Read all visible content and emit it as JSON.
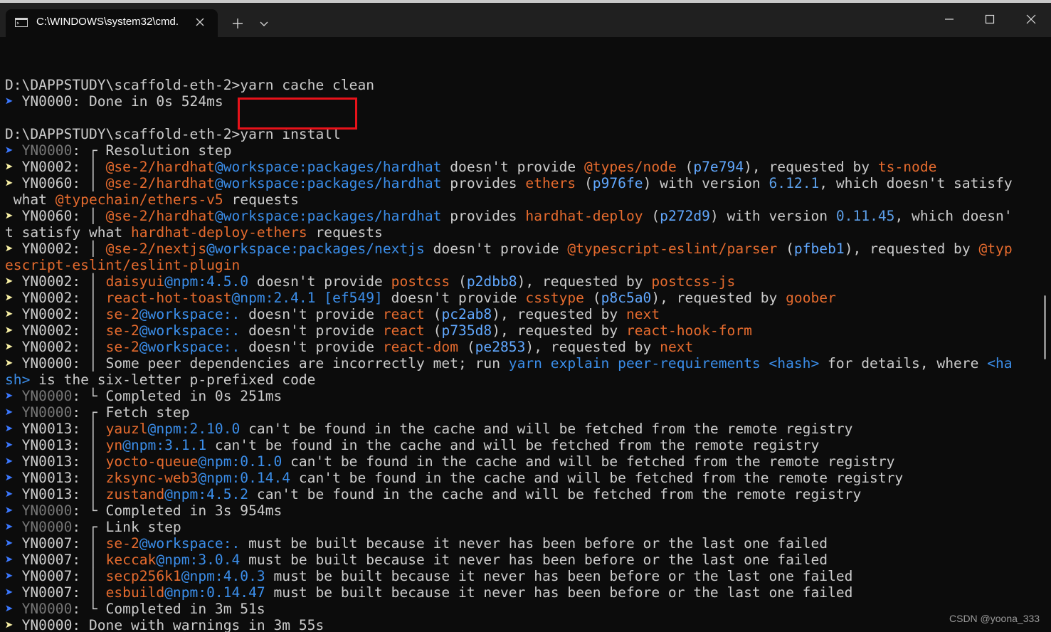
{
  "window": {
    "tab_title": "C:\\WINDOWS\\system32\\cmd.",
    "tab_icon": "terminal-icon"
  },
  "colors": {
    "background": "#0c0c0c",
    "titlebar": "#202020",
    "text": "#cccccc",
    "package_orange": "#e66b2e",
    "workspace_blue": "#3b8eea",
    "arrow_blue": "#3b78ff",
    "arrow_yellow": "#f9f1a5",
    "highlight_red": "#e8121a"
  },
  "lines": [
    [],
    [
      {
        "t": "D:\\DAPPSTUDY\\scaffold-eth-2>yarn cache clean",
        "c": "prompt"
      }
    ],
    [
      {
        "t": "➤",
        "c": "arrow-blue"
      },
      {
        "t": " YN0000: Done in 0s 524ms",
        "c": "text"
      }
    ],
    [],
    [
      {
        "t": "D:\\DAPPSTUDY\\scaffold-eth-2>yarn install",
        "c": "prompt"
      }
    ],
    [
      {
        "t": "➤",
        "c": "arrow-blue"
      },
      {
        "t": " YN0000",
        "c": "code-dim"
      },
      {
        "t": ": ┌ Resolution step",
        "c": "text"
      }
    ],
    [
      {
        "t": "➤",
        "c": "arrow-yellow"
      },
      {
        "t": " YN0002",
        "c": "code"
      },
      {
        "t": ": │ ",
        "c": "text"
      },
      {
        "t": "@se-2/hardhat",
        "c": "pkg"
      },
      {
        "t": "@workspace:packages/hardhat",
        "c": "ws"
      },
      {
        "t": " doesn't provide ",
        "c": "text"
      },
      {
        "t": "@types/node",
        "c": "pkg"
      },
      {
        "t": " (",
        "c": "text"
      },
      {
        "t": "p7e794",
        "c": "ver"
      },
      {
        "t": "), requested by ",
        "c": "text"
      },
      {
        "t": "ts-node",
        "c": "pkg"
      }
    ],
    [
      {
        "t": "➤",
        "c": "arrow-yellow"
      },
      {
        "t": " YN0060",
        "c": "code"
      },
      {
        "t": ": │ ",
        "c": "text"
      },
      {
        "t": "@se-2/hardhat",
        "c": "pkg"
      },
      {
        "t": "@workspace:packages/hardhat",
        "c": "ws"
      },
      {
        "t": " provides ",
        "c": "text"
      },
      {
        "t": "ethers",
        "c": "pkg"
      },
      {
        "t": " (",
        "c": "text"
      },
      {
        "t": "p976fe",
        "c": "ver"
      },
      {
        "t": ") with version ",
        "c": "text"
      },
      {
        "t": "6.12.1",
        "c": "ver2"
      },
      {
        "t": ", which doesn't satisfy",
        "c": "text"
      }
    ],
    [
      {
        "t": " what ",
        "c": "text"
      },
      {
        "t": "@typechain/ethers-v5",
        "c": "pkg"
      },
      {
        "t": " requests",
        "c": "text"
      }
    ],
    [
      {
        "t": "➤",
        "c": "arrow-yellow"
      },
      {
        "t": " YN0060",
        "c": "code"
      },
      {
        "t": ": │ ",
        "c": "text"
      },
      {
        "t": "@se-2/hardhat",
        "c": "pkg"
      },
      {
        "t": "@workspace:packages/hardhat",
        "c": "ws"
      },
      {
        "t": " provides ",
        "c": "text"
      },
      {
        "t": "hardhat-deploy",
        "c": "pkg"
      },
      {
        "t": " (",
        "c": "text"
      },
      {
        "t": "p272d9",
        "c": "ver"
      },
      {
        "t": ") with version ",
        "c": "text"
      },
      {
        "t": "0.11.45",
        "c": "ver2"
      },
      {
        "t": ", which doesn'",
        "c": "text"
      }
    ],
    [
      {
        "t": "t satisfy what ",
        "c": "text"
      },
      {
        "t": "hardhat-deploy-ethers",
        "c": "pkg"
      },
      {
        "t": " requests",
        "c": "text"
      }
    ],
    [
      {
        "t": "➤",
        "c": "arrow-yellow"
      },
      {
        "t": " YN0002",
        "c": "code"
      },
      {
        "t": ": │ ",
        "c": "text"
      },
      {
        "t": "@se-2/nextjs",
        "c": "pkg"
      },
      {
        "t": "@workspace:packages/nextjs",
        "c": "ws"
      },
      {
        "t": " doesn't provide ",
        "c": "text"
      },
      {
        "t": "@typescript-eslint/parser",
        "c": "pkg"
      },
      {
        "t": " (",
        "c": "text"
      },
      {
        "t": "pfbeb1",
        "c": "ver"
      },
      {
        "t": "), requested by ",
        "c": "text"
      },
      {
        "t": "@typ",
        "c": "pkg"
      }
    ],
    [
      {
        "t": "escript-eslint/eslint-plugin",
        "c": "pkg"
      }
    ],
    [
      {
        "t": "➤",
        "c": "arrow-yellow"
      },
      {
        "t": " YN0002",
        "c": "code"
      },
      {
        "t": ": │ ",
        "c": "text"
      },
      {
        "t": "daisyui",
        "c": "pkg"
      },
      {
        "t": "@npm:4.5.0",
        "c": "ws"
      },
      {
        "t": " doesn't provide ",
        "c": "text"
      },
      {
        "t": "postcss",
        "c": "pkg"
      },
      {
        "t": " (",
        "c": "text"
      },
      {
        "t": "p2dbb8",
        "c": "ver"
      },
      {
        "t": "), requested by ",
        "c": "text"
      },
      {
        "t": "postcss-js",
        "c": "pkg"
      }
    ],
    [
      {
        "t": "➤",
        "c": "arrow-yellow"
      },
      {
        "t": " YN0002",
        "c": "code"
      },
      {
        "t": ": │ ",
        "c": "text"
      },
      {
        "t": "react-hot-toast",
        "c": "pkg"
      },
      {
        "t": "@npm:2.4.1 [ef549]",
        "c": "ws"
      },
      {
        "t": " doesn't provide ",
        "c": "text"
      },
      {
        "t": "csstype",
        "c": "pkg"
      },
      {
        "t": " (",
        "c": "text"
      },
      {
        "t": "p8c5a0",
        "c": "ver"
      },
      {
        "t": "), requested by ",
        "c": "text"
      },
      {
        "t": "goober",
        "c": "pkg"
      }
    ],
    [
      {
        "t": "➤",
        "c": "arrow-yellow"
      },
      {
        "t": " YN0002",
        "c": "code"
      },
      {
        "t": ": │ ",
        "c": "text"
      },
      {
        "t": "se-2",
        "c": "pkg"
      },
      {
        "t": "@workspace:.",
        "c": "ws"
      },
      {
        "t": " doesn't provide ",
        "c": "text"
      },
      {
        "t": "react",
        "c": "pkg"
      },
      {
        "t": " (",
        "c": "text"
      },
      {
        "t": "pc2ab8",
        "c": "ver"
      },
      {
        "t": "), requested by ",
        "c": "text"
      },
      {
        "t": "next",
        "c": "pkg"
      }
    ],
    [
      {
        "t": "➤",
        "c": "arrow-yellow"
      },
      {
        "t": " YN0002",
        "c": "code"
      },
      {
        "t": ": │ ",
        "c": "text"
      },
      {
        "t": "se-2",
        "c": "pkg"
      },
      {
        "t": "@workspace:.",
        "c": "ws"
      },
      {
        "t": " doesn't provide ",
        "c": "text"
      },
      {
        "t": "react",
        "c": "pkg"
      },
      {
        "t": " (",
        "c": "text"
      },
      {
        "t": "p735d8",
        "c": "ver"
      },
      {
        "t": "), requested by ",
        "c": "text"
      },
      {
        "t": "react-hook-form",
        "c": "pkg"
      }
    ],
    [
      {
        "t": "➤",
        "c": "arrow-yellow"
      },
      {
        "t": " YN0002",
        "c": "code"
      },
      {
        "t": ": │ ",
        "c": "text"
      },
      {
        "t": "se-2",
        "c": "pkg"
      },
      {
        "t": "@workspace:.",
        "c": "ws"
      },
      {
        "t": " doesn't provide ",
        "c": "text"
      },
      {
        "t": "react-dom",
        "c": "pkg"
      },
      {
        "t": " (",
        "c": "text"
      },
      {
        "t": "pe2853",
        "c": "ver"
      },
      {
        "t": "), requested by ",
        "c": "text"
      },
      {
        "t": "next",
        "c": "pkg"
      }
    ],
    [
      {
        "t": "➤",
        "c": "arrow-yellow"
      },
      {
        "t": " YN0000",
        "c": "code"
      },
      {
        "t": ": │ Some peer dependencies are incorrectly met; run ",
        "c": "text"
      },
      {
        "t": "yarn explain peer-requirements <hash>",
        "c": "link"
      },
      {
        "t": " for details, where ",
        "c": "text"
      },
      {
        "t": "<ha",
        "c": "link"
      }
    ],
    [
      {
        "t": "sh>",
        "c": "link"
      },
      {
        "t": " is the six-letter p-prefixed code",
        "c": "text"
      }
    ],
    [
      {
        "t": "➤",
        "c": "arrow-blue"
      },
      {
        "t": " YN0000",
        "c": "code-dim"
      },
      {
        "t": ": └ Completed in 0s 251ms",
        "c": "text"
      }
    ],
    [
      {
        "t": "➤",
        "c": "arrow-blue"
      },
      {
        "t": " YN0000",
        "c": "code-dim"
      },
      {
        "t": ": ┌ Fetch step",
        "c": "text"
      }
    ],
    [
      {
        "t": "➤",
        "c": "arrow-blue"
      },
      {
        "t": " YN0013",
        "c": "code"
      },
      {
        "t": ": │ ",
        "c": "text"
      },
      {
        "t": "yauzl",
        "c": "pkg"
      },
      {
        "t": "@npm:2.10.0",
        "c": "ws"
      },
      {
        "t": " can't be found in the cache and will be fetched from the remote registry",
        "c": "text"
      }
    ],
    [
      {
        "t": "➤",
        "c": "arrow-blue"
      },
      {
        "t": " YN0013",
        "c": "code"
      },
      {
        "t": ": │ ",
        "c": "text"
      },
      {
        "t": "yn",
        "c": "pkg"
      },
      {
        "t": "@npm:3.1.1",
        "c": "ws"
      },
      {
        "t": " can't be found in the cache and will be fetched from the remote registry",
        "c": "text"
      }
    ],
    [
      {
        "t": "➤",
        "c": "arrow-blue"
      },
      {
        "t": " YN0013",
        "c": "code"
      },
      {
        "t": ": │ ",
        "c": "text"
      },
      {
        "t": "yocto-queue",
        "c": "pkg"
      },
      {
        "t": "@npm:0.1.0",
        "c": "ws"
      },
      {
        "t": " can't be found in the cache and will be fetched from the remote registry",
        "c": "text"
      }
    ],
    [
      {
        "t": "➤",
        "c": "arrow-blue"
      },
      {
        "t": " YN0013",
        "c": "code"
      },
      {
        "t": ": │ ",
        "c": "text"
      },
      {
        "t": "zksync-web3",
        "c": "pkg"
      },
      {
        "t": "@npm:0.14.4",
        "c": "ws"
      },
      {
        "t": " can't be found in the cache and will be fetched from the remote registry",
        "c": "text"
      }
    ],
    [
      {
        "t": "➤",
        "c": "arrow-blue"
      },
      {
        "t": " YN0013",
        "c": "code"
      },
      {
        "t": ": │ ",
        "c": "text"
      },
      {
        "t": "zustand",
        "c": "pkg"
      },
      {
        "t": "@npm:4.5.2",
        "c": "ws"
      },
      {
        "t": " can't be found in the cache and will be fetched from the remote registry",
        "c": "text"
      }
    ],
    [
      {
        "t": "➤",
        "c": "arrow-blue"
      },
      {
        "t": " YN0000",
        "c": "code-dim"
      },
      {
        "t": ": └ Completed in 3s 954ms",
        "c": "text"
      }
    ],
    [
      {
        "t": "➤",
        "c": "arrow-blue"
      },
      {
        "t": " YN0000",
        "c": "code-dim"
      },
      {
        "t": ": ┌ Link step",
        "c": "text"
      }
    ],
    [
      {
        "t": "➤",
        "c": "arrow-blue"
      },
      {
        "t": " YN0007",
        "c": "code"
      },
      {
        "t": ": │ ",
        "c": "text"
      },
      {
        "t": "se-2",
        "c": "pkg"
      },
      {
        "t": "@workspace:.",
        "c": "ws"
      },
      {
        "t": " must be built because it never has been before or the last one failed",
        "c": "text"
      }
    ],
    [
      {
        "t": "➤",
        "c": "arrow-blue"
      },
      {
        "t": " YN0007",
        "c": "code"
      },
      {
        "t": ": │ ",
        "c": "text"
      },
      {
        "t": "keccak",
        "c": "pkg"
      },
      {
        "t": "@npm:3.0.4",
        "c": "ws"
      },
      {
        "t": " must be built because it never has been before or the last one failed",
        "c": "text"
      }
    ],
    [
      {
        "t": "➤",
        "c": "arrow-blue"
      },
      {
        "t": " YN0007",
        "c": "code"
      },
      {
        "t": ": │ ",
        "c": "text"
      },
      {
        "t": "secp256k1",
        "c": "pkg"
      },
      {
        "t": "@npm:4.0.3",
        "c": "ws"
      },
      {
        "t": " must be built because it never has been before or the last one failed",
        "c": "text"
      }
    ],
    [
      {
        "t": "➤",
        "c": "arrow-blue"
      },
      {
        "t": " YN0007",
        "c": "code"
      },
      {
        "t": ": │ ",
        "c": "text"
      },
      {
        "t": "esbuild",
        "c": "pkg"
      },
      {
        "t": "@npm:0.14.47",
        "c": "ws"
      },
      {
        "t": " must be built because it never has been before or the last one failed",
        "c": "text"
      }
    ],
    [
      {
        "t": "➤",
        "c": "arrow-blue"
      },
      {
        "t": " YN0000",
        "c": "code-dim"
      },
      {
        "t": ": └ Completed in 3m 51s",
        "c": "text"
      }
    ],
    [
      {
        "t": "➤",
        "c": "arrow-yellow"
      },
      {
        "t": " YN0000: Done with warnings in 3m 55s",
        "c": "text"
      }
    ]
  ],
  "watermark": "CSDN @yoona_333"
}
